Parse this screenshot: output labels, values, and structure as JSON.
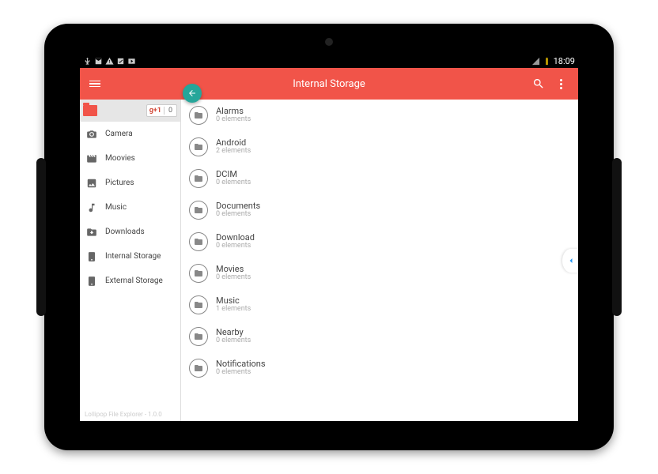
{
  "status_bar": {
    "time": "18:09"
  },
  "app_bar": {
    "title": "Internal Storage"
  },
  "sidebar": {
    "gplus_label": "g+1",
    "gplus_count": "0",
    "items": [
      {
        "icon": "camera-icon",
        "label": "Camera"
      },
      {
        "icon": "movie-icon",
        "label": "Moovies"
      },
      {
        "icon": "picture-icon",
        "label": "Pictures"
      },
      {
        "icon": "music-icon",
        "label": "Music"
      },
      {
        "icon": "download-icon",
        "label": "Downloads"
      },
      {
        "icon": "storage-icon",
        "label": "Internal Storage"
      },
      {
        "icon": "storage-icon",
        "label": "External Storage"
      }
    ],
    "footer": "Lollipop File Explorer - 1.0.0"
  },
  "folders": [
    {
      "name": "Alarms",
      "sub": "0 elements"
    },
    {
      "name": "Android",
      "sub": "2 elements"
    },
    {
      "name": "DCIM",
      "sub": "0 elements"
    },
    {
      "name": "Documents",
      "sub": "0 elements"
    },
    {
      "name": "Download",
      "sub": "0 elements"
    },
    {
      "name": "Movies",
      "sub": "0 elements"
    },
    {
      "name": "Music",
      "sub": "1 elements"
    },
    {
      "name": "Nearby",
      "sub": "0 elements"
    },
    {
      "name": "Notifications",
      "sub": "0 elements"
    }
  ]
}
